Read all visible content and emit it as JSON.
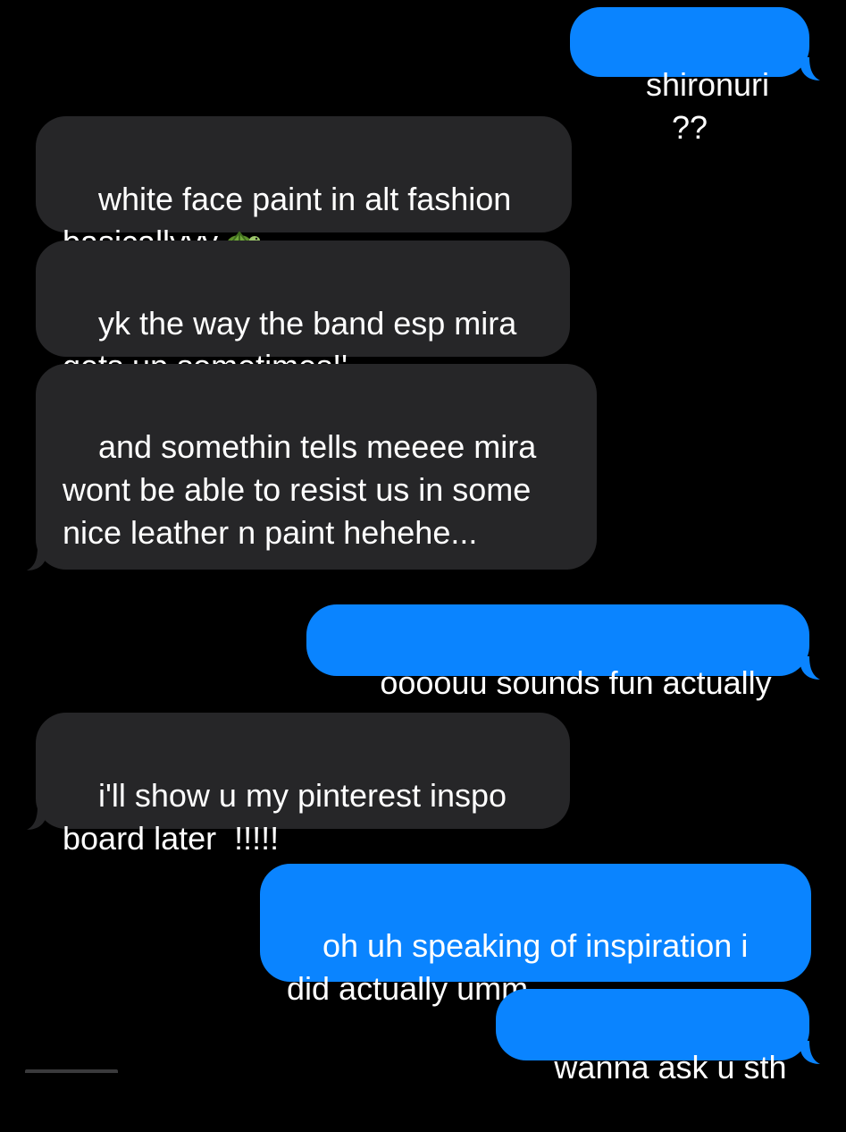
{
  "conversation": {
    "messages": [
      {
        "direction": "sent",
        "text": "shironuri ??"
      },
      {
        "direction": "received",
        "text": "white face paint in alt fashion basicallyyy",
        "emoji": "turtle-emoji"
      },
      {
        "direction": "received",
        "text": "yk the way the band esp mira gets up sometimes!'"
      },
      {
        "direction": "received",
        "text": "and somethin tells meeee mira wont be able to resist us in some nice leather n paint hehehe..."
      },
      {
        "direction": "sent",
        "text": "oooouu sounds fun actually"
      },
      {
        "direction": "received",
        "text": "i'll show u my pinterest inspo board later  !!!!!"
      },
      {
        "direction": "sent",
        "text": "oh uh speaking of inspiration i did actually umm"
      },
      {
        "direction": "sent",
        "text": "wanna ask u sth"
      }
    ]
  },
  "colors": {
    "background": "#000000",
    "sent_bubble": "#0a84ff",
    "received_bubble": "#262628",
    "text": "#ffffff"
  }
}
